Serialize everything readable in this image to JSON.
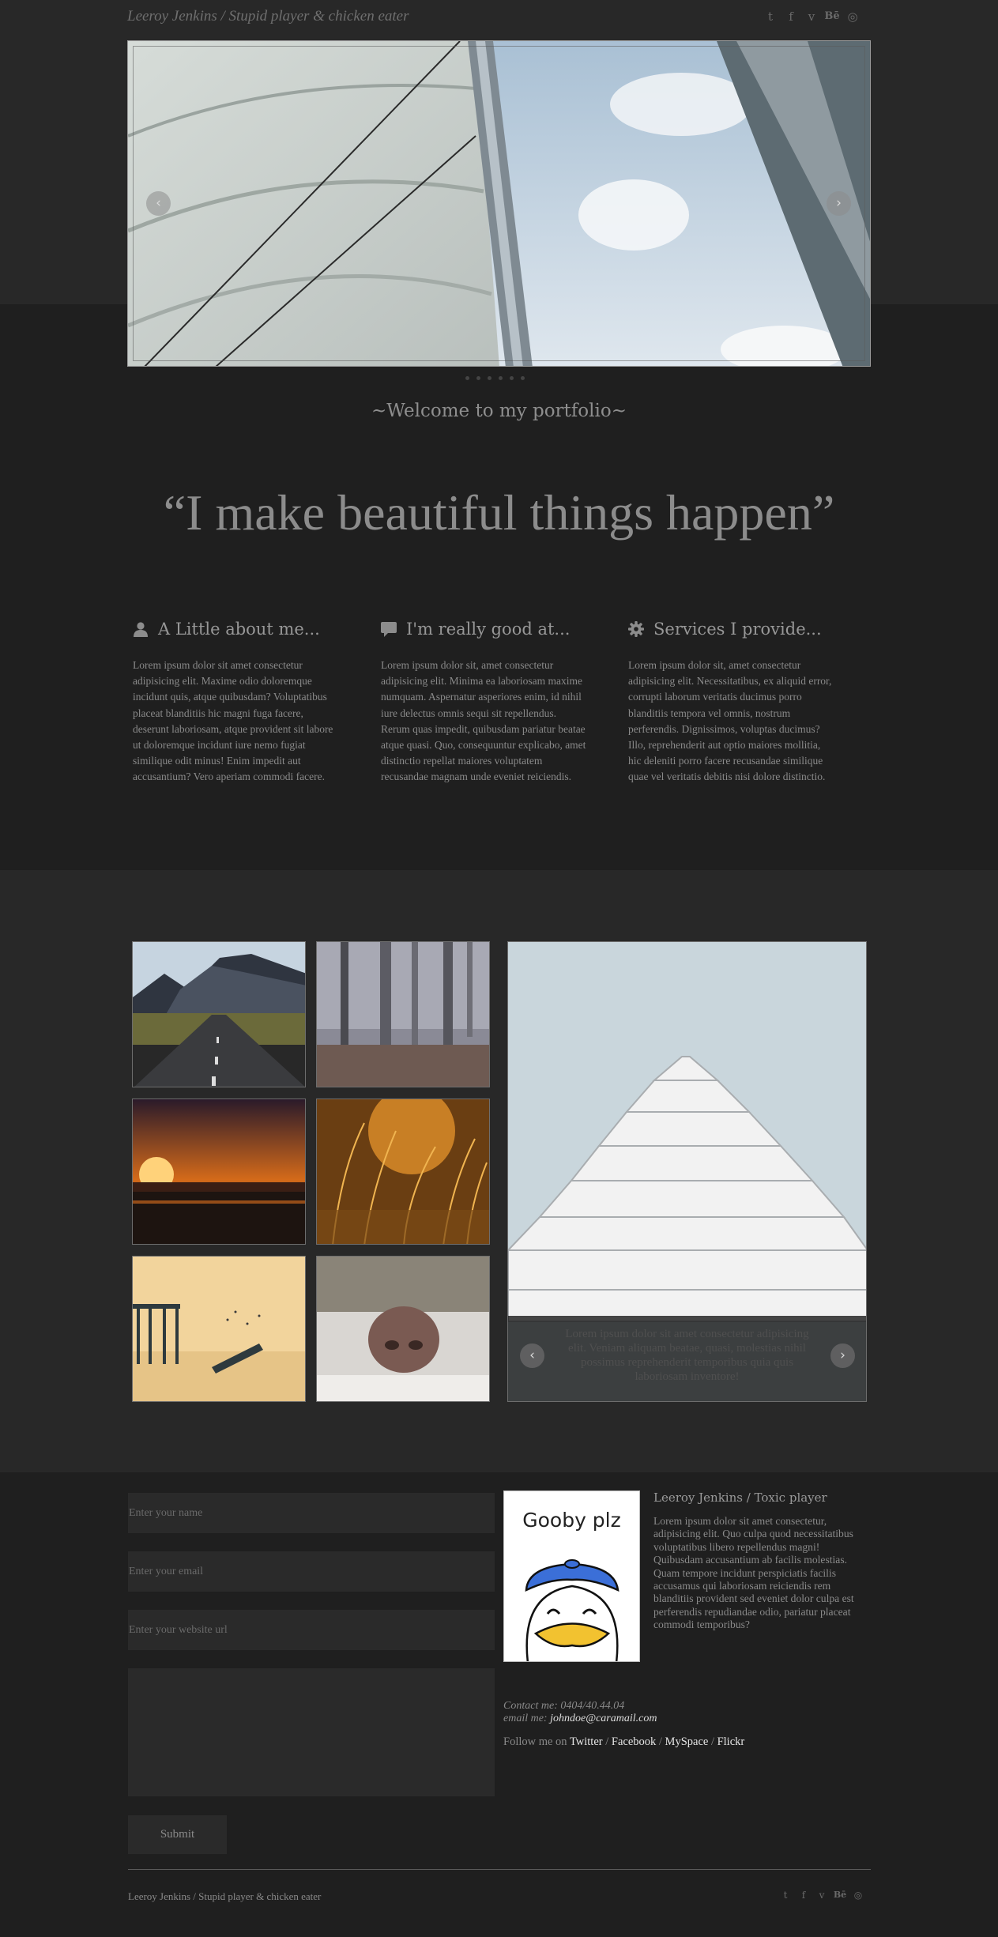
{
  "header": {
    "site_title": "Leeroy Jenkins / Stupid player & chicken eater",
    "social": [
      {
        "icon": "twitter-icon",
        "glyph": "t"
      },
      {
        "icon": "facebook-icon",
        "glyph": "f"
      },
      {
        "icon": "vimeo-icon",
        "glyph": "v"
      },
      {
        "icon": "behance-icon",
        "glyph": "Bē"
      },
      {
        "icon": "dribbble-icon",
        "glyph": "◎"
      }
    ]
  },
  "slider": {
    "prev_glyph": "‹",
    "next_glyph": "›",
    "dot_count": 6
  },
  "intro": {
    "welcome": "~Welcome to my portfolio~",
    "quote": "“I make beautiful things happen”"
  },
  "columns": [
    {
      "icon": "user-icon",
      "title": "A Little about me...",
      "text": "Lorem ipsum dolor sit amet consectetur adipisicing elit. Maxime odio doloremque incidunt quis, atque quibusdam? Voluptatibus placeat blanditiis hic magni fuga facere, deserunt laboriosam, atque provident sit labore ut doloremque incidunt iure nemo fugiat similique odit minus! Enim impedit aut accusantium? Vero aperiam commodi facere."
    },
    {
      "icon": "comment-icon",
      "title": "I'm really good at...",
      "text": "Lorem ipsum dolor sit, amet consectetur adipisicing elit. Minima ea laboriosam maxime numquam. Aspernatur asperiores enim, id nihil iure delectus omnis sequi sit repellendus. Rerum quas impedit, quibusdam pariatur beatae atque quasi. Quo, consequuntur explicabo, amet distinctio repellat maiores voluptatem recusandae magnam unde eveniet reiciendis."
    },
    {
      "icon": "gear-icon",
      "title": "Services I provide...",
      "text": "Lorem ipsum dolor sit, amet consectetur adipisicing elit. Necessitatibus, ex aliquid error, corrupti laborum veritatis ducimus porro blanditiis tempora vel omnis, nostrum perferendis. Dignissimos, voluptas ducimus? Illo, reprehenderit aut optio maiores mollitia, hic deleniti porro facere recusandae similique quae vel veritatis debitis nisi dolore distinctio."
    }
  ],
  "gallery": {
    "caption": "Lorem ipsum dolor sit amet consectetur adipisicing elit. Veniam aliquam beatae, quasi, molestias nihil possimus reprehenderit temporibus quia quis laboriosam inventore!",
    "prev_glyph": "‹",
    "next_glyph": "›"
  },
  "contact_form": {
    "name_placeholder": "Enter your name",
    "email_placeholder": "Enter your email",
    "website_placeholder": "Enter your website url",
    "message_placeholder": "",
    "submit_label": "Submit"
  },
  "profile": {
    "avatar_caption": "Gooby plz",
    "name": "Leeroy Jenkins / Toxic player",
    "bio": "Lorem ipsum dolor sit amet consectetur, adipisicing elit. Quo culpa quod necessitatibus voluptatibus libero repellendus magni! Quibusdam accusantium ab facilis molestias. Quam tempore incidunt perspiciatis facilis accusamus qui laboriosam reiciendis rem blanditiis provident sed eveniet dolor culpa est perferendis repudiandae odio, pariatur placeat commodi temporibus?",
    "contact_label": "Contact me:",
    "phone": "0404/40.44.04",
    "email_label": "email me:",
    "email": "johndoe@caramail.com",
    "follow_label": "Follow me on",
    "links": [
      "Twitter",
      "Facebook",
      "MySpace",
      "Flickr"
    ],
    "separator": " / "
  },
  "footer": {
    "title": "Leeroy Jenkins / Stupid player & chicken eater"
  },
  "colors": {
    "background": "#1f1f1f",
    "band": "#282828",
    "text": "#8c8c8c",
    "link": "#e6e6e6"
  }
}
